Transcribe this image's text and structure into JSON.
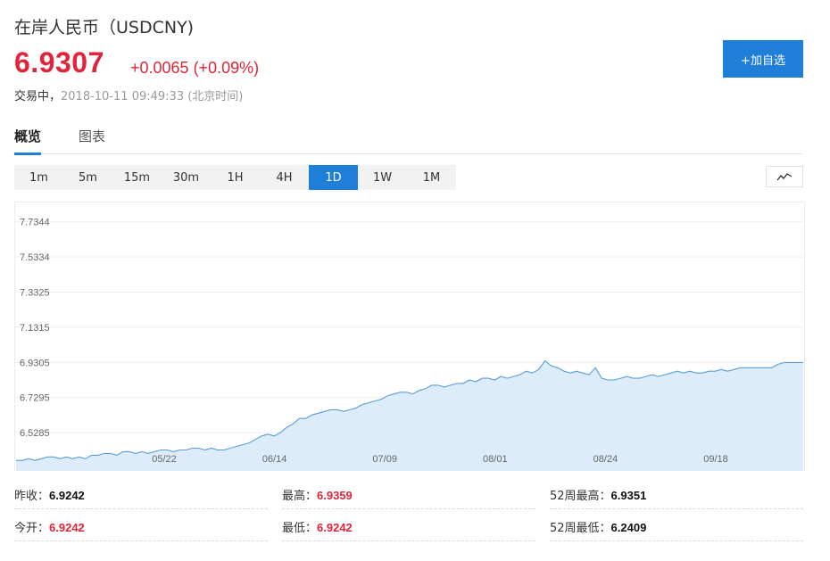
{
  "header": {
    "title": "在岸人民币（USDCNY)",
    "price": "6.9307",
    "change": "+0.0065 (+0.09%)",
    "status": "交易中，",
    "timestamp": "2018-10-11 09:49:33 (北京时间)",
    "add_button": "+加自选"
  },
  "tabs": [
    "概览",
    "图表"
  ],
  "periods": [
    "1m",
    "5m",
    "15m",
    "30m",
    "1H",
    "4H",
    "1D",
    "1W",
    "1M"
  ],
  "active_period": "1D",
  "chart_data": {
    "type": "area",
    "yticks": [
      "7.7344",
      "7.5334",
      "7.3325",
      "7.1315",
      "6.9305",
      "6.7295",
      "6.5285"
    ],
    "xticks": [
      "05/22",
      "06/14",
      "07/09",
      "08/01",
      "08/24",
      "09/18"
    ],
    "ylim": [
      6.31,
      7.85
    ],
    "grid": "horizontal",
    "line_color": "#5b9bd5",
    "fill_color": "#dcecfb",
    "series": [
      {
        "values": [
          6.37,
          6.37,
          6.38,
          6.37,
          6.38,
          6.39,
          6.39,
          6.38,
          6.39,
          6.38,
          6.39,
          6.38,
          6.4,
          6.4,
          6.41,
          6.41,
          6.4,
          6.42,
          6.42,
          6.41,
          6.42,
          6.41,
          6.42,
          6.43,
          6.43,
          6.42,
          6.43,
          6.43,
          6.44,
          6.44,
          6.43,
          6.44,
          6.43,
          6.43,
          6.44,
          6.45,
          6.46,
          6.47,
          6.49,
          6.51,
          6.52,
          6.51,
          6.53,
          6.56,
          6.58,
          6.61,
          6.61,
          6.63,
          6.64,
          6.65,
          6.66,
          6.66,
          6.65,
          6.66,
          6.67,
          6.69,
          6.7,
          6.71,
          6.72,
          6.74,
          6.75,
          6.76,
          6.76,
          6.75,
          6.77,
          6.78,
          6.8,
          6.8,
          6.79,
          6.8,
          6.81,
          6.81,
          6.83,
          6.82,
          6.84,
          6.84,
          6.83,
          6.85,
          6.84,
          6.85,
          6.86,
          6.88,
          6.87,
          6.89,
          6.94,
          6.91,
          6.9,
          6.88,
          6.87,
          6.88,
          6.87,
          6.86,
          6.9,
          6.84,
          6.83,
          6.83,
          6.84,
          6.85,
          6.84,
          6.84,
          6.85,
          6.86,
          6.85,
          6.86,
          6.87,
          6.88,
          6.87,
          6.88,
          6.87,
          6.87,
          6.88,
          6.88,
          6.89,
          6.88,
          6.89,
          6.9,
          6.9,
          6.9,
          6.9,
          6.9,
          6.9,
          6.92,
          6.93,
          6.93,
          6.93,
          6.93
        ]
      }
    ]
  },
  "stats": [
    {
      "label": "昨收：",
      "value": "6.9242",
      "color": "dark"
    },
    {
      "label": "最高：",
      "value": "6.9359",
      "color": "red"
    },
    {
      "label": "52周最高：",
      "value": "6.9351",
      "color": "dark"
    },
    {
      "label": "今开：",
      "value": "6.9242",
      "color": "red"
    },
    {
      "label": "最低：",
      "value": "6.9242",
      "color": "red"
    },
    {
      "label": "52周最低：",
      "value": "6.2409",
      "color": "dark"
    }
  ]
}
